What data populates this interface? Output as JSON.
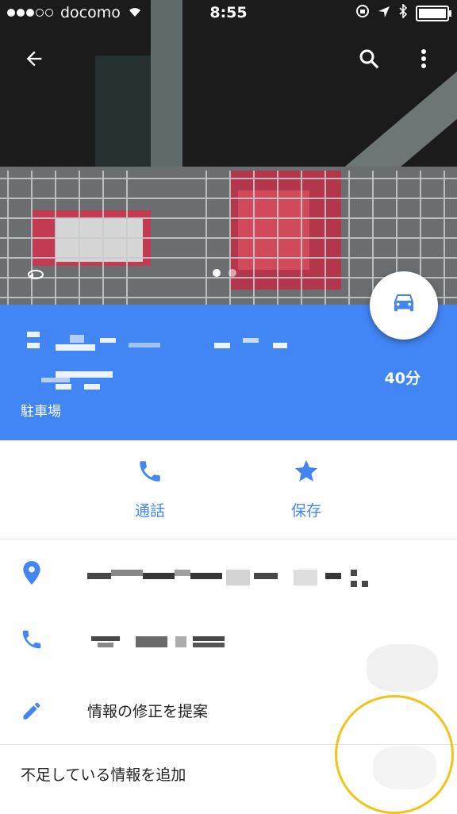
{
  "status_bar": {
    "carrier": "docomo",
    "time": "8:55"
  },
  "header": {
    "back_icon": "arrow-back-icon",
    "search_icon": "search-icon",
    "more_icon": "more-vert-icon"
  },
  "photo": {
    "total_pages": 2,
    "current_page": 1
  },
  "place": {
    "category": "駐車場",
    "travel_time": "40分",
    "directions_icon": "car-icon"
  },
  "actions": [
    {
      "label": "通話",
      "icon": "phone-icon"
    },
    {
      "label": "保存",
      "icon": "star-icon"
    }
  ],
  "details": {
    "address_icon": "location-pin-icon",
    "phone_icon": "phone-icon",
    "suggest_edit": "情報の修正を提案",
    "add_missing": "不足している情報を追加"
  },
  "colors": {
    "accent": "#4285f4",
    "highlight_circle": "#f3c21b"
  }
}
